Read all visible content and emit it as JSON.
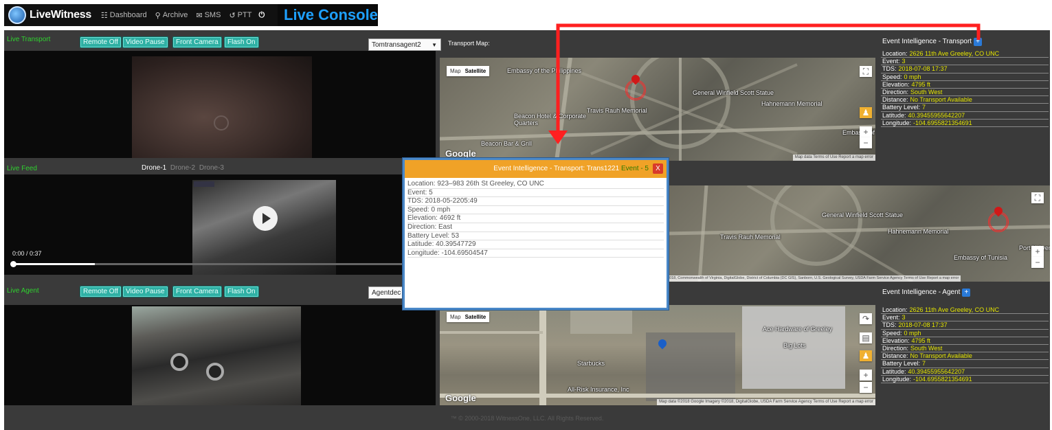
{
  "nav": {
    "brand": "LiveWitness",
    "items": [
      {
        "icon": "dashboard-icon",
        "label": "Dashboard"
      },
      {
        "icon": "archive-pin-icon",
        "label": "Archive"
      },
      {
        "icon": "sms-icon",
        "label": "SMS"
      },
      {
        "icon": "ptt-icon",
        "label": "PTT"
      }
    ],
    "console_title": "Live Console"
  },
  "transport": {
    "label": "Live Transport",
    "buttons": [
      "Remote Off",
      "Video Pause",
      "Front Camera",
      "Flash On"
    ],
    "select_value": "Tomtransagent2",
    "map_label": "Transport Map:"
  },
  "feed": {
    "label": "Live Feed",
    "drones": [
      "Drone-1",
      "Drone-2",
      "Drone-3"
    ],
    "time": "0:00 / 0:37"
  },
  "agent": {
    "label": "Live Agent",
    "buttons": [
      "Remote Off",
      "Video Pause",
      "Front Camera",
      "Flash On"
    ],
    "select_value": "Agentdec"
  },
  "map_ui": {
    "map": "Map",
    "satellite": "Satellite",
    "google": "Google",
    "attrib_top": "Map data  Terms of Use  Report a map error",
    "attrib_mid": "2018, Commonwealth of Virginia, DigitalGlobe, District of Columbia (DC GIS), Sanborn, U.S. Geological Survey, USDA Farm Service Agency   Terms of Use   Report a map error",
    "attrib_bottom": "Map data ©2018 Google Imagery ©2018, DigitalGlobe, USDA Farm Service Agency   Terms of Use   Report a map error",
    "labels_top": [
      "Embassy of the Philippines",
      "General Winfield Scott Statue",
      "Hahnemann Memorial",
      "Travis Rauh Memorial",
      "Beacon Hotel & Corporate Quarters",
      "Beacon Bar & Grill",
      "Embassy of"
    ],
    "labels_mid": [
      "General Winfield Scott Statue",
      "Hahnemann Memorial",
      "Travis Rauh Memorial",
      "Embassy of Tunisia",
      "Port N Avenu"
    ],
    "labels_bottom": [
      "Ace Hardware of Greeley",
      "Big Lots",
      "Starbucks",
      "All-Risk Insurance, Inc"
    ]
  },
  "transport_info": {
    "title": "Event Intelligence - Transport",
    "rows": [
      {
        "k": "Location:",
        "v": "2626 11th Ave Greeley, CO UNC"
      },
      {
        "k": "Event:",
        "v": "3"
      },
      {
        "k": "TDS:",
        "v": "2018-07-08 17:37"
      },
      {
        "k": "Speed:",
        "v": "0 mph"
      },
      {
        "k": "Elevation:",
        "v": "4795 ft"
      },
      {
        "k": "Direction:",
        "v": "South West"
      },
      {
        "k": "Distance:",
        "v": "No Transport Available"
      },
      {
        "k": "Battery Level:",
        "v": "7"
      },
      {
        "k": "Latitude:",
        "v": "40.39455955642207"
      },
      {
        "k": "Longitude:",
        "v": "-104.6955821354691"
      }
    ]
  },
  "agent_info": {
    "title": "Event Intelligence - Agent",
    "rows": [
      {
        "k": "Location:",
        "v": "2626 11th Ave Greeley, CO UNC"
      },
      {
        "k": "Event:",
        "v": "3"
      },
      {
        "k": "TDS:",
        "v": "2018-07-08 17:37"
      },
      {
        "k": "Speed:",
        "v": "0 mph"
      },
      {
        "k": "Elevation:",
        "v": "4795 ft"
      },
      {
        "k": "Direction:",
        "v": "South West"
      },
      {
        "k": "Distance:",
        "v": "No Transport Available"
      },
      {
        "k": "Battery Level:",
        "v": "7"
      },
      {
        "k": "Latitude:",
        "v": "40.39455955642207"
      },
      {
        "k": "Longitude:",
        "v": "-104.6955821354691"
      }
    ]
  },
  "popup": {
    "title": "Event Intelligence - Transport: Trans1221",
    "event_tag": "Event - 5",
    "close": "X",
    "rows": [
      "Location:  923–983 26th St Greeley, CO UNC",
      "Event:  5",
      "TDS:  2018-05-2205:49",
      "Speed:  0 mph",
      "Elevation:  4692 ft",
      "Direction:  East",
      "Battery Level:  53",
      "Latitude:  40.39547729",
      "Longitude:  -104.69504547"
    ]
  },
  "footer": "™ © 2000-2018 WitnessOne, LLC. All Rights Reserved.",
  "colors": {
    "accent_blue": "#1ea0ff",
    "live_green": "#2fd12f",
    "button_teal": "#2fb0a4",
    "info_yellow": "#e6e600",
    "popup_orange": "#f0a227",
    "arrow_red": "#ff2020"
  }
}
